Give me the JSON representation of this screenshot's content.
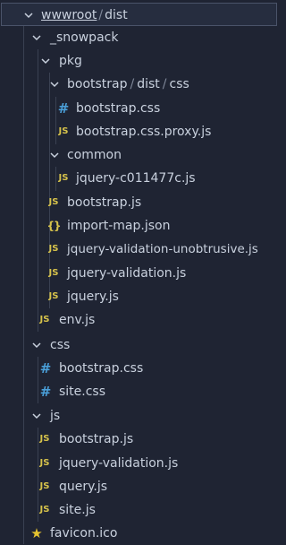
{
  "tree": {
    "root": {
      "seg1": "wwwroot",
      "sep": "/",
      "seg2": "dist"
    },
    "snowpack": "_snowpack",
    "pkg": "pkg",
    "bootstrap_path": {
      "seg1": "bootstrap",
      "sep1": "/",
      "seg2": "dist",
      "sep2": "/",
      "seg3": "css"
    },
    "files": {
      "bootstrap_css_1": "bootstrap.css",
      "bootstrap_proxy": "bootstrap.css.proxy.js",
      "common": "common",
      "jquery_hash": "jquery-c011477c.js",
      "bootstrap_js_1": "bootstrap.js",
      "import_map": "import-map.json",
      "jq_val_unob": "jquery-validation-unobtrusive.js",
      "jq_val_1": "jquery-validation.js",
      "jquery_js": "jquery.js",
      "env_js": "env.js",
      "css_folder": "css",
      "bootstrap_css_2": "bootstrap.css",
      "site_css": "site.css",
      "js_folder": "js",
      "bootstrap_js_2": "bootstrap.js",
      "jq_val_2": "jquery-validation.js",
      "query_js": "query.js",
      "site_js": "site.js",
      "favicon": "favicon.ico"
    },
    "icons": {
      "js": "JS",
      "css": "#",
      "json": "{}",
      "star": "★"
    }
  },
  "colors": {
    "background": "#1f2433",
    "text": "#c9d1de",
    "js_icon": "#d6c24b",
    "css_icon": "#4a9fd8",
    "star_icon": "#e6c430",
    "selection_border": "#4a5369"
  }
}
